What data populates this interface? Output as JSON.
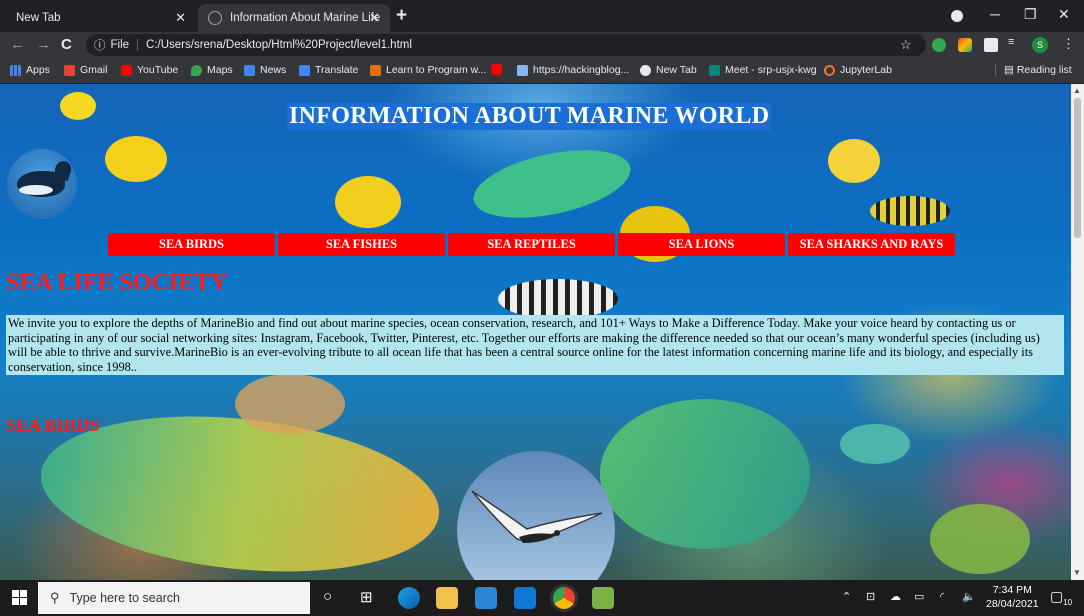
{
  "browser": {
    "tabs": [
      {
        "title": "New Tab"
      },
      {
        "title": "Information About Marine Life"
      }
    ],
    "address": {
      "prefix": "File",
      "url": "C:/Users/srena/Desktop/Html%20Project/level1.html"
    },
    "bookmarks": [
      "Apps",
      "Gmail",
      "YouTube",
      "Maps",
      "News",
      "Translate",
      "Learn to Program w...",
      "https://hackingblog...",
      "New Tab",
      "Meet - srp-usjx-kwg",
      "JupyterLab"
    ],
    "reading_list": "Reading list",
    "profile_initial": "S"
  },
  "page": {
    "title": "INFORMATION ABOUT MARINE WORLD",
    "nav": [
      "SEA BIRDS",
      "SEA FISHES",
      "SEA REPTILES",
      "SEA LIONS",
      "SEA SHARKS AND RAYS"
    ],
    "society_heading": "SEA LIFE SOCIETY",
    "intro": "We invite you to explore the depths of MarineBio and find out about marine species, ocean conservation, research, and 101+ Ways to Make a Difference Today. Make your voice heard by contacting us or participating in any of our social networking sites: Instagram, Facebook, Twitter, Pinterest, etc. Together our efforts are making the difference needed so that our ocean’s many wonderful species (including us) will be able to thrive and survive.MarineBio is an ever-evolving tribute to all ocean life that has been a central source online for the latest information concerning marine life and its biology, and especially its conservation, since 1998..",
    "section_heading": "SEA BIRDS",
    "colors": {
      "nav_bg": "#ff0000",
      "heading": "#ff1a1a",
      "intro_bg": "#b2e6ee",
      "title_bg": "#1a6fd6"
    }
  },
  "taskbar": {
    "search_placeholder": "Type here to search",
    "time": "7:34 PM",
    "date": "28/04/2021",
    "notifications": "10"
  }
}
